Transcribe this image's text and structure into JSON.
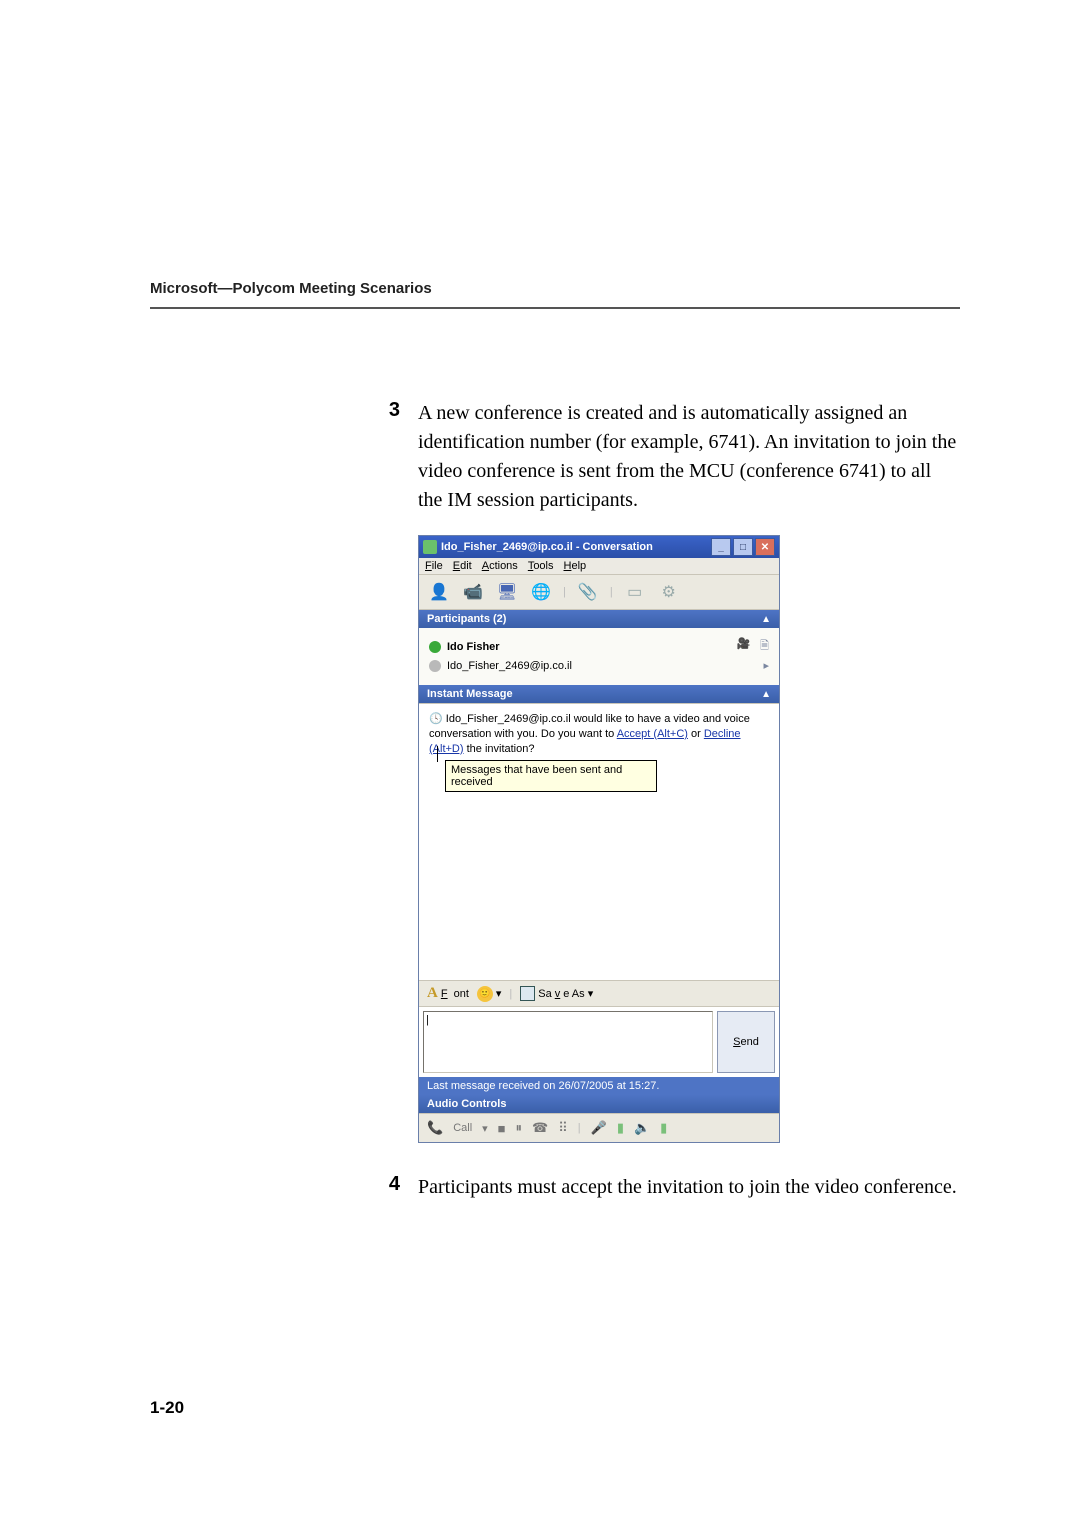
{
  "header": {
    "title": "Microsoft—Polycom Meeting Scenarios"
  },
  "steps": {
    "s3": {
      "num": "3",
      "text": "A new conference is created and is automatically assigned an identification number (for example, 6741). An invitation to join the video conference is sent from the MCU (conference 6741) to all the IM session participants."
    },
    "s4": {
      "num": "4",
      "text": "Participants must accept the invitation to join the video conference."
    }
  },
  "page_number": "1-20",
  "window": {
    "title": "Ido_Fisher_2469@ip.co.il - Conversation",
    "menus": {
      "file": "File",
      "edit": "Edit",
      "actions": "Actions",
      "tools": "Tools",
      "help": "Help"
    },
    "sections": {
      "participants_title": "Participants (2)",
      "im_title": "Instant Message",
      "audio_title": "Audio Controls"
    },
    "participants": [
      {
        "name": "Ido Fisher"
      },
      {
        "name": "Ido_Fisher_2469@ip.co.il"
      }
    ],
    "im": {
      "message_prefix": "Ido_Fisher_2469@ip.co.il would like to have a video and voice conversation with you. Do you want to ",
      "accept": "Accept (Alt+C)",
      "middle": " or ",
      "decline": "Decline (Alt+D)",
      "suffix": " the invitation?",
      "tooltip": "Messages that have been sent and received"
    },
    "format": {
      "font": "Font",
      "saveas": "Save As"
    },
    "input": {
      "placeholder": "",
      "send": "Send"
    },
    "status": "Last message received on 26/07/2005 at 15:27.",
    "audio": {
      "call": "Call"
    }
  }
}
